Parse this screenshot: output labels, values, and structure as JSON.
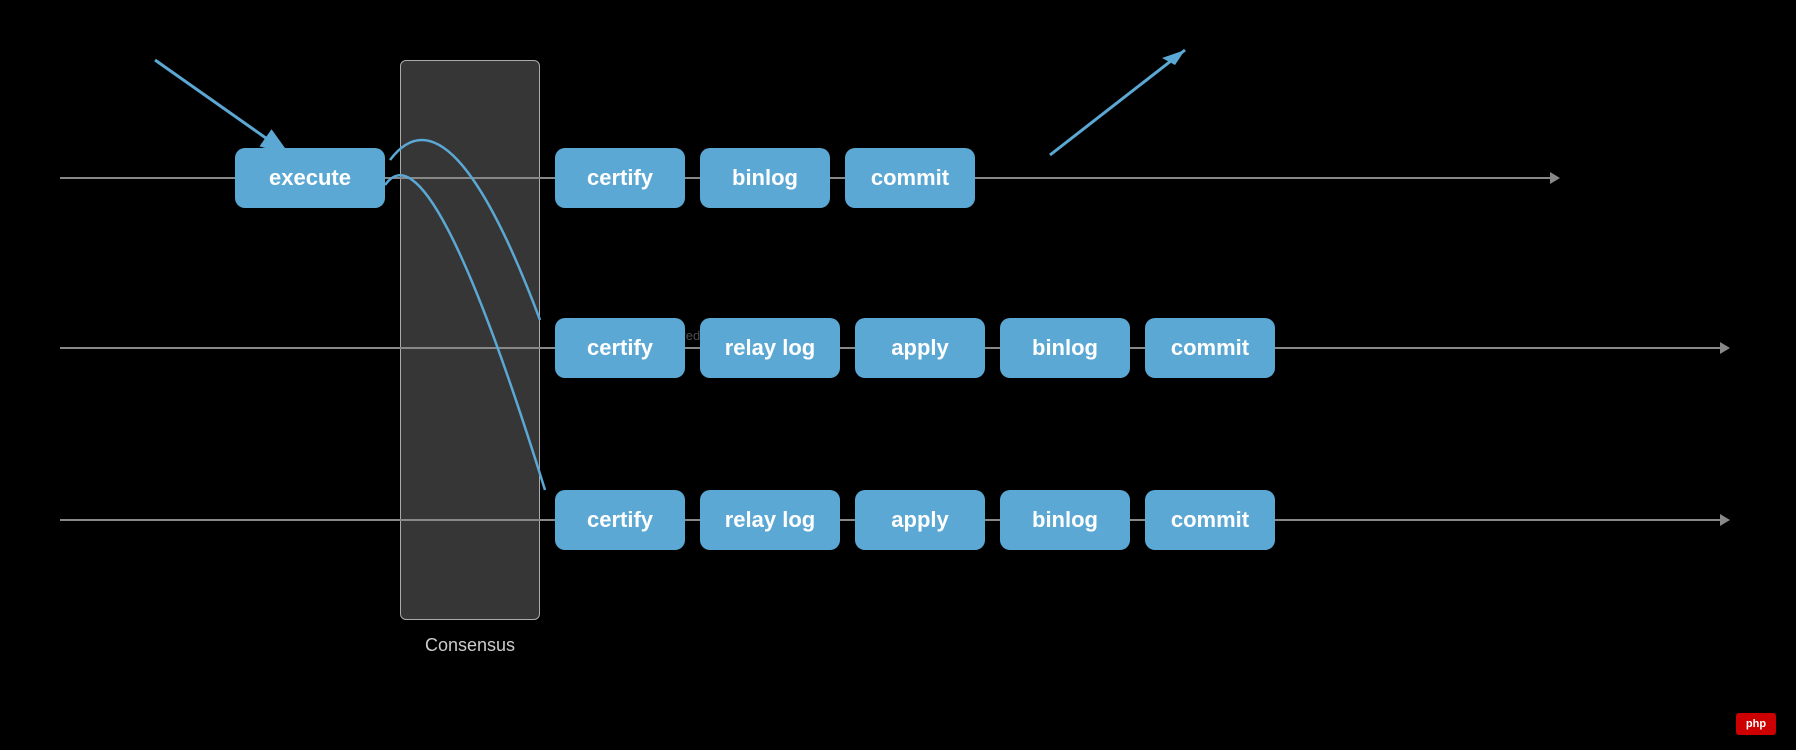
{
  "nodes": {
    "execute": "execute",
    "r1": {
      "certify": "certify",
      "binlog": "binlog",
      "commit": "commit"
    },
    "r2": {
      "certify": "certify",
      "relaylog": "relay log",
      "apply": "apply",
      "binlog": "binlog",
      "commit": "commit"
    },
    "r3": {
      "certify": "certify",
      "relaylog": "relay log",
      "apply": "apply",
      "binlog": "binlog",
      "commit": "commit"
    }
  },
  "consensus_label": "Consensus",
  "watermark": "http://blue-redo.net/mongodb",
  "php_label": "php",
  "colors": {
    "node_bg": "#5ba8d4",
    "node_text": "#ffffff",
    "arrow": "#5ba8d4",
    "line": "#888888",
    "consensus_bg": "rgba(180,180,180,0.3)",
    "background": "#000000"
  }
}
